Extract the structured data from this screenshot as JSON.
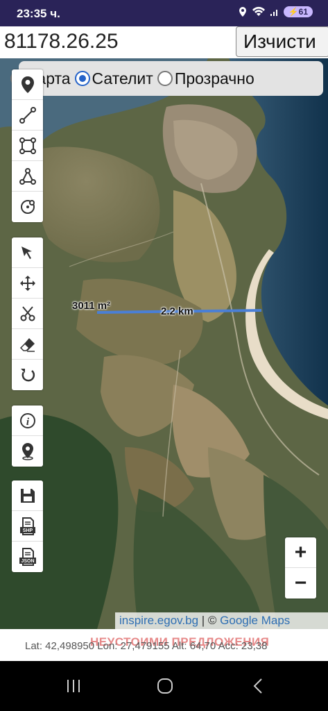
{
  "status_bar": {
    "time": "23:35 ч.",
    "battery": "61"
  },
  "search": {
    "value": "81178.26.25"
  },
  "clear_button": {
    "label": "Изчисти"
  },
  "layers": {
    "options": [
      {
        "label": "Карта",
        "selected": false
      },
      {
        "label": "Сателит",
        "selected": true
      },
      {
        "label": "Прозрачно",
        "selected": false
      }
    ]
  },
  "tools": {
    "group1": [
      "location-pin-icon",
      "draw-line-icon",
      "draw-rectangle-icon",
      "draw-polygon-icon",
      "draw-circle-icon"
    ],
    "group2": [
      "select-pointer-icon",
      "move-icon",
      "scissors-icon",
      "eraser-icon",
      "undo-icon"
    ],
    "group3": [
      "info-icon",
      "gps-location-icon"
    ],
    "group4": [
      "save-icon",
      "shp-file-icon",
      "json-file-icon"
    ]
  },
  "map": {
    "area_label": "3011 m²",
    "distance_label": "2.2 km",
    "line_color": "#4a7fd6"
  },
  "zoom": {
    "in": "+",
    "out": "−"
  },
  "attribution": {
    "source": "inspire.egov.bg",
    "separator": " | © ",
    "provider": "Google Maps"
  },
  "coords": {
    "text": "Lat: 42,498950 Lon: 27,479155 Alt: 64,70 Acc: 23,38",
    "watermark": "НЕУСТОИМИ ПРЕДЛОЖЕНИЯ"
  }
}
